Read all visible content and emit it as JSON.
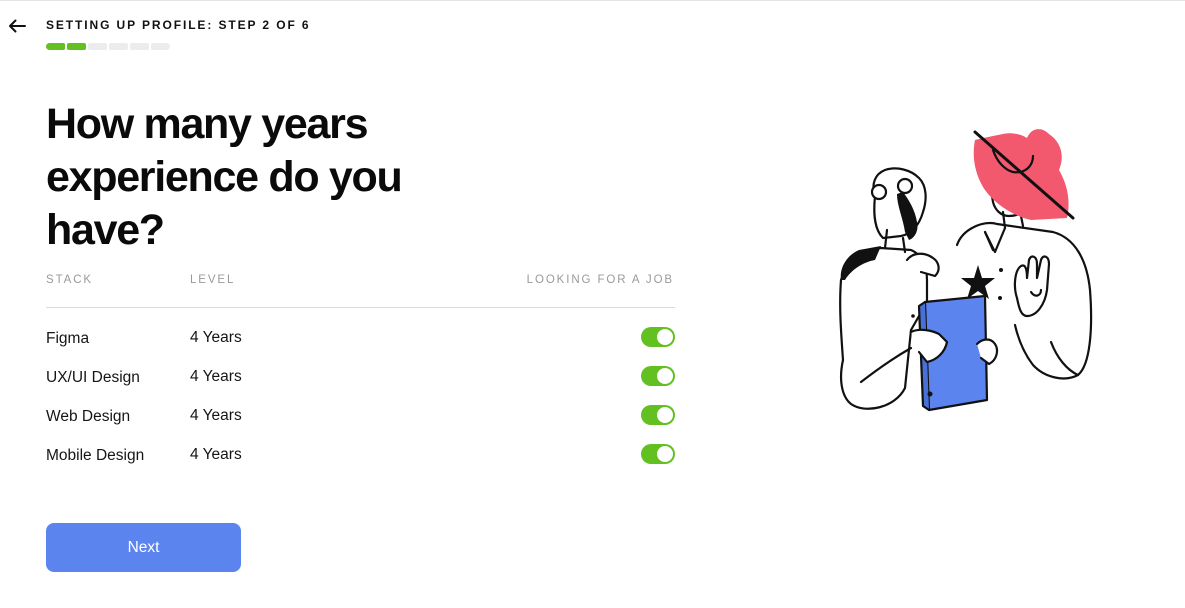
{
  "header": {
    "back_icon": "arrow-left-icon",
    "step_label": "SETTING UP PROFILE: STEP 2 OF 6",
    "progress": {
      "current_step": 2,
      "total_steps": 6,
      "active_color": "#62c020"
    }
  },
  "main": {
    "question": "How many years experience do you have?",
    "table": {
      "columns": [
        "STACK",
        "LEVEL",
        "LOOKING FOR A JOB"
      ],
      "rows": [
        {
          "stack": "Figma",
          "level": "4 Years",
          "looking_for_job": true
        },
        {
          "stack": "UX/UI Design",
          "level": "4 Years",
          "looking_for_job": true
        },
        {
          "stack": "Web Design",
          "level": "4 Years",
          "looking_for_job": true
        },
        {
          "stack": "Mobile Design",
          "level": "4 Years",
          "looking_for_job": true
        }
      ]
    },
    "next_label": "Next"
  },
  "illustration": {
    "icon": "two-people-with-folder-illustration",
    "colors": {
      "hat": "#f2586e",
      "folder": "#5b84ef",
      "line": "#111111"
    }
  },
  "colors": {
    "accent": "#62c020",
    "button": "#5b84ef"
  }
}
